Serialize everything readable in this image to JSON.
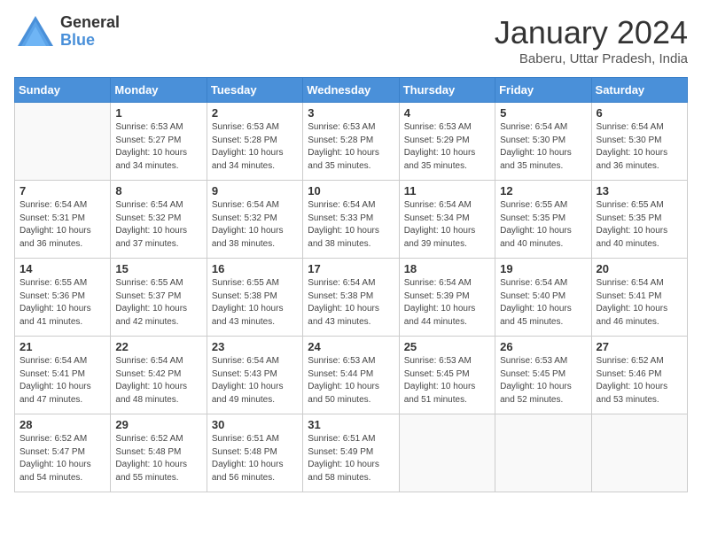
{
  "header": {
    "logo_general": "General",
    "logo_blue": "Blue",
    "month_title": "January 2024",
    "subtitle": "Baberu, Uttar Pradesh, India"
  },
  "calendar": {
    "days_of_week": [
      "Sunday",
      "Monday",
      "Tuesday",
      "Wednesday",
      "Thursday",
      "Friday",
      "Saturday"
    ],
    "weeks": [
      [
        {
          "day": "",
          "info": ""
        },
        {
          "day": "1",
          "info": "Sunrise: 6:53 AM\nSunset: 5:27 PM\nDaylight: 10 hours\nand 34 minutes."
        },
        {
          "day": "2",
          "info": "Sunrise: 6:53 AM\nSunset: 5:28 PM\nDaylight: 10 hours\nand 34 minutes."
        },
        {
          "day": "3",
          "info": "Sunrise: 6:53 AM\nSunset: 5:28 PM\nDaylight: 10 hours\nand 35 minutes."
        },
        {
          "day": "4",
          "info": "Sunrise: 6:53 AM\nSunset: 5:29 PM\nDaylight: 10 hours\nand 35 minutes."
        },
        {
          "day": "5",
          "info": "Sunrise: 6:54 AM\nSunset: 5:30 PM\nDaylight: 10 hours\nand 35 minutes."
        },
        {
          "day": "6",
          "info": "Sunrise: 6:54 AM\nSunset: 5:30 PM\nDaylight: 10 hours\nand 36 minutes."
        }
      ],
      [
        {
          "day": "7",
          "info": "Sunrise: 6:54 AM\nSunset: 5:31 PM\nDaylight: 10 hours\nand 36 minutes."
        },
        {
          "day": "8",
          "info": "Sunrise: 6:54 AM\nSunset: 5:32 PM\nDaylight: 10 hours\nand 37 minutes."
        },
        {
          "day": "9",
          "info": "Sunrise: 6:54 AM\nSunset: 5:32 PM\nDaylight: 10 hours\nand 38 minutes."
        },
        {
          "day": "10",
          "info": "Sunrise: 6:54 AM\nSunset: 5:33 PM\nDaylight: 10 hours\nand 38 minutes."
        },
        {
          "day": "11",
          "info": "Sunrise: 6:54 AM\nSunset: 5:34 PM\nDaylight: 10 hours\nand 39 minutes."
        },
        {
          "day": "12",
          "info": "Sunrise: 6:55 AM\nSunset: 5:35 PM\nDaylight: 10 hours\nand 40 minutes."
        },
        {
          "day": "13",
          "info": "Sunrise: 6:55 AM\nSunset: 5:35 PM\nDaylight: 10 hours\nand 40 minutes."
        }
      ],
      [
        {
          "day": "14",
          "info": "Sunrise: 6:55 AM\nSunset: 5:36 PM\nDaylight: 10 hours\nand 41 minutes."
        },
        {
          "day": "15",
          "info": "Sunrise: 6:55 AM\nSunset: 5:37 PM\nDaylight: 10 hours\nand 42 minutes."
        },
        {
          "day": "16",
          "info": "Sunrise: 6:55 AM\nSunset: 5:38 PM\nDaylight: 10 hours\nand 43 minutes."
        },
        {
          "day": "17",
          "info": "Sunrise: 6:54 AM\nSunset: 5:38 PM\nDaylight: 10 hours\nand 43 minutes."
        },
        {
          "day": "18",
          "info": "Sunrise: 6:54 AM\nSunset: 5:39 PM\nDaylight: 10 hours\nand 44 minutes."
        },
        {
          "day": "19",
          "info": "Sunrise: 6:54 AM\nSunset: 5:40 PM\nDaylight: 10 hours\nand 45 minutes."
        },
        {
          "day": "20",
          "info": "Sunrise: 6:54 AM\nSunset: 5:41 PM\nDaylight: 10 hours\nand 46 minutes."
        }
      ],
      [
        {
          "day": "21",
          "info": "Sunrise: 6:54 AM\nSunset: 5:41 PM\nDaylight: 10 hours\nand 47 minutes."
        },
        {
          "day": "22",
          "info": "Sunrise: 6:54 AM\nSunset: 5:42 PM\nDaylight: 10 hours\nand 48 minutes."
        },
        {
          "day": "23",
          "info": "Sunrise: 6:54 AM\nSunset: 5:43 PM\nDaylight: 10 hours\nand 49 minutes."
        },
        {
          "day": "24",
          "info": "Sunrise: 6:53 AM\nSunset: 5:44 PM\nDaylight: 10 hours\nand 50 minutes."
        },
        {
          "day": "25",
          "info": "Sunrise: 6:53 AM\nSunset: 5:45 PM\nDaylight: 10 hours\nand 51 minutes."
        },
        {
          "day": "26",
          "info": "Sunrise: 6:53 AM\nSunset: 5:45 PM\nDaylight: 10 hours\nand 52 minutes."
        },
        {
          "day": "27",
          "info": "Sunrise: 6:52 AM\nSunset: 5:46 PM\nDaylight: 10 hours\nand 53 minutes."
        }
      ],
      [
        {
          "day": "28",
          "info": "Sunrise: 6:52 AM\nSunset: 5:47 PM\nDaylight: 10 hours\nand 54 minutes."
        },
        {
          "day": "29",
          "info": "Sunrise: 6:52 AM\nSunset: 5:48 PM\nDaylight: 10 hours\nand 55 minutes."
        },
        {
          "day": "30",
          "info": "Sunrise: 6:51 AM\nSunset: 5:48 PM\nDaylight: 10 hours\nand 56 minutes."
        },
        {
          "day": "31",
          "info": "Sunrise: 6:51 AM\nSunset: 5:49 PM\nDaylight: 10 hours\nand 58 minutes."
        },
        {
          "day": "",
          "info": ""
        },
        {
          "day": "",
          "info": ""
        },
        {
          "day": "",
          "info": ""
        }
      ]
    ]
  }
}
